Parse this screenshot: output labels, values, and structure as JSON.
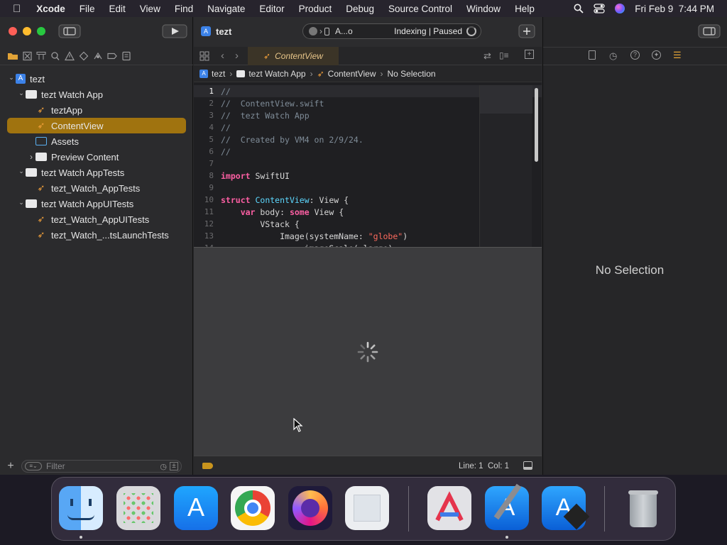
{
  "menubar": {
    "app": "Xcode",
    "items": [
      "File",
      "Edit",
      "View",
      "Find",
      "Navigate",
      "Editor",
      "Product",
      "Debug",
      "Source Control",
      "Window",
      "Help"
    ],
    "datetime": "Fri Feb 9  7:44 PM"
  },
  "toolbar": {
    "activity_scheme": "A...o",
    "activity_status": "Indexing | Paused",
    "project_title": "tezt"
  },
  "navigator": {
    "tree": [
      {
        "label": "tezt",
        "kind": "project",
        "depth": 0,
        "disclosure": "open"
      },
      {
        "label": "tezt Watch App",
        "kind": "folder",
        "depth": 1,
        "disclosure": "open"
      },
      {
        "label": "teztApp",
        "kind": "swift",
        "depth": 2
      },
      {
        "label": "ContentView",
        "kind": "swift",
        "depth": 2,
        "selected": true
      },
      {
        "label": "Assets",
        "kind": "assets",
        "depth": 2
      },
      {
        "label": "Preview Content",
        "kind": "folder",
        "depth": 2,
        "disclosure": "closed"
      },
      {
        "label": "tezt Watch AppTests",
        "kind": "folder",
        "depth": 1,
        "disclosure": "open"
      },
      {
        "label": "tezt_Watch_AppTests",
        "kind": "swift",
        "depth": 2
      },
      {
        "label": "tezt Watch AppUITests",
        "kind": "folder",
        "depth": 1,
        "disclosure": "open"
      },
      {
        "label": "tezt_Watch_AppUITests",
        "kind": "swift",
        "depth": 2
      },
      {
        "label": "tezt_Watch_...tsLaunchTests",
        "kind": "swift",
        "depth": 2
      }
    ],
    "filter_placeholder": "Filter"
  },
  "editor": {
    "tab": "ContentView",
    "jumpbar": [
      "tezt",
      "tezt Watch App",
      "ContentView",
      "No Selection"
    ],
    "code_lines": [
      {
        "n": "1",
        "text": "//",
        "kind": "comment"
      },
      {
        "n": "2",
        "text": "//  ContentView.swift",
        "kind": "comment"
      },
      {
        "n": "3",
        "text": "//  tezt Watch App",
        "kind": "comment"
      },
      {
        "n": "4",
        "text": "//",
        "kind": "comment"
      },
      {
        "n": "5",
        "text": "//  Created by VM4 on 2/9/24.",
        "kind": "comment"
      },
      {
        "n": "6",
        "text": "//",
        "kind": "comment"
      },
      {
        "n": "7",
        "text": "",
        "kind": "plain"
      },
      {
        "n": "8",
        "text": "import SwiftUI",
        "kind": "import"
      },
      {
        "n": "9",
        "text": "",
        "kind": "plain"
      },
      {
        "n": "10",
        "text": "struct ContentView: View {",
        "kind": "struct"
      },
      {
        "n": "11",
        "text": "    var body: some View {",
        "kind": "var"
      },
      {
        "n": "12",
        "text": "        VStack {",
        "kind": "plain"
      },
      {
        "n": "13",
        "text": "            Image(systemName: \"globe\")",
        "kind": "image"
      },
      {
        "n": "14",
        "text": "                .imageScale(.large)",
        "kind": "plain"
      }
    ],
    "status_line": "Line: 1",
    "status_col": "Col: 1"
  },
  "inspector": {
    "empty_label": "No Selection"
  },
  "dock": {
    "apps": [
      "Finder",
      "Launchpad",
      "App Store",
      "Google Chrome",
      "Firefox",
      "Preview",
      "Affinity",
      "Xcode",
      "Simulator",
      "Trash"
    ]
  },
  "colors": {
    "selection": "#a0730f",
    "swift_orange": "#f4a13b",
    "keyword": "#fc5fa3",
    "type": "#5dd8ff",
    "string": "#fc6a5d",
    "comment": "#7f8c98"
  }
}
